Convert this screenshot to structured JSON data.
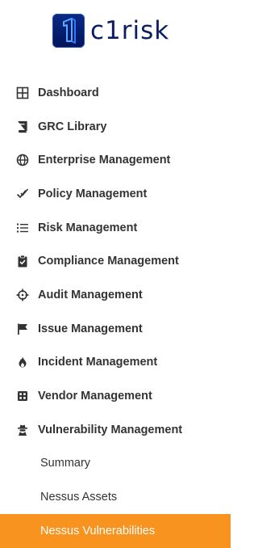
{
  "brand": {
    "name": "c1risk",
    "accent_color": "#0b1d63",
    "active_color": "#f7931e"
  },
  "nav": {
    "items": [
      {
        "label": "Dashboard",
        "icon": "grid-icon"
      },
      {
        "label": "GRC Library",
        "icon": "book-icon"
      },
      {
        "label": "Enterprise Management",
        "icon": "globe-icon"
      },
      {
        "label": "Policy Management",
        "icon": "double-check-icon"
      },
      {
        "label": "Risk Management",
        "icon": "list-icon"
      },
      {
        "label": "Compliance Management",
        "icon": "clipboard-check-icon"
      },
      {
        "label": "Audit Management",
        "icon": "crosshair-icon"
      },
      {
        "label": "Issue Management",
        "icon": "flag-icon"
      },
      {
        "label": "Incident Management",
        "icon": "fire-icon"
      },
      {
        "label": "Vendor Management",
        "icon": "vendor-icon"
      },
      {
        "label": "Vulnerability Management",
        "icon": "spy-icon"
      }
    ],
    "sub_items": [
      {
        "label": "Summary",
        "active": false
      },
      {
        "label": "Nessus Assets",
        "active": false
      },
      {
        "label": "Nessus Vulnerabilities",
        "active": true
      }
    ]
  }
}
